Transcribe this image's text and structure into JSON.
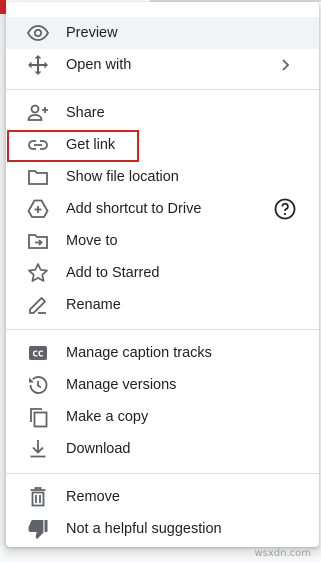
{
  "menu": {
    "items": [
      {
        "key": "preview",
        "label": "Preview",
        "icon": "eye-icon"
      },
      {
        "key": "open_with",
        "label": "Open with",
        "icon": "move-icon"
      },
      {
        "key": "share",
        "label": "Share",
        "icon": "person-add-icon"
      },
      {
        "key": "get_link",
        "label": "Get link",
        "icon": "link-icon"
      },
      {
        "key": "show_file_location",
        "label": "Show file location",
        "icon": "folder-icon"
      },
      {
        "key": "add_shortcut",
        "label": "Add shortcut to Drive",
        "icon": "add-to-drive-icon"
      },
      {
        "key": "move_to",
        "label": "Move to",
        "icon": "move-to-folder-icon"
      },
      {
        "key": "add_starred",
        "label": "Add to Starred",
        "icon": "star-icon"
      },
      {
        "key": "rename",
        "label": "Rename",
        "icon": "pencil-icon"
      },
      {
        "key": "caption_tracks",
        "label": "Manage caption tracks",
        "icon": "closed-caption-icon"
      },
      {
        "key": "manage_versions",
        "label": "Manage versions",
        "icon": "history-icon"
      },
      {
        "key": "make_copy",
        "label": "Make a copy",
        "icon": "copy-icon"
      },
      {
        "key": "download",
        "label": "Download",
        "icon": "download-icon"
      },
      {
        "key": "remove",
        "label": "Remove",
        "icon": "trash-icon"
      },
      {
        "key": "not_helpful",
        "label": "Not a helpful suggestion",
        "icon": "thumbs-down-icon"
      }
    ],
    "hovered_item": "Preview",
    "highlighted_item": "Get link",
    "submenu_icon": "chevron-right-icon",
    "help_icon": "help-circle-icon"
  },
  "colors": {
    "icon": "#5f6368",
    "text": "#202124",
    "hover_bg": "#f1f3f4",
    "divider": "#dadce0",
    "highlight_border": "#c62828"
  },
  "watermark": "wsxdn.com"
}
